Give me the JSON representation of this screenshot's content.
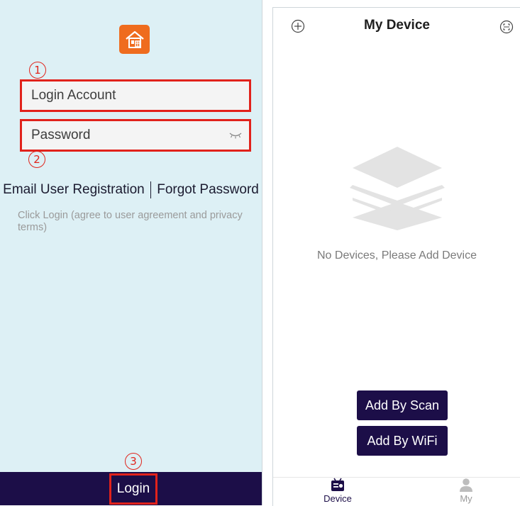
{
  "login": {
    "annotation_1": "①",
    "annotation_2": "②",
    "annotation_3": "③",
    "account_placeholder": "Login Account",
    "password_placeholder": "Password",
    "email_registration": "Email User Registration",
    "forgot_password": "Forgot Password",
    "agreement_text": "Click Login (agree to user agreement and privacy terms)",
    "login_button": "Login"
  },
  "device": {
    "title": "My Device",
    "empty_message": "No Devices, Please Add Device",
    "add_by_scan": "Add By Scan",
    "add_by_wifi": "Add By WiFi",
    "tabs": [
      {
        "label": "Device",
        "icon": "device-icon",
        "active": true
      },
      {
        "label": "My",
        "icon": "person-icon",
        "active": false
      }
    ]
  },
  "colors": {
    "brand_dark": "#1c0e48",
    "logo_orange": "#ef6c1e",
    "annotation_red": "#e1221b",
    "login_bg": "#ddf0f5"
  }
}
